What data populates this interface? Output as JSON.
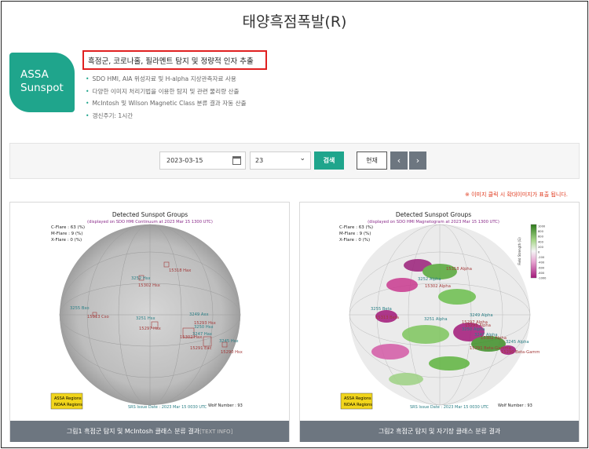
{
  "page": {
    "title": "태양흑점폭발(R)"
  },
  "logo": {
    "line1": "ASSA",
    "line2": "Sunspot"
  },
  "intro": {
    "headline": "흑점군, 코로나홀, 필라멘트 탐지 및 정량적 인자 추출",
    "bullets": [
      "SDO HMI, AIA 위성자료 및 H-alpha 지상관측자료 사용",
      "다양한 이미지 처리기법을 이용한 탐지 및 관련 물리량 산출",
      "McIntosh 및 Wilson Magnetic Class 분류 결과 자동 산출",
      "갱신주기: 1시간"
    ]
  },
  "search": {
    "date": "2023-03-15",
    "hour": "23",
    "search_label": "검색",
    "now_label": "현재",
    "prev_icon": "chevron-left-icon",
    "next_icon": "chevron-right-icon"
  },
  "notice": "※ 이미지 클릭 시 확대이미지가 표출 됩니다.",
  "colors": {
    "accent": "#1fa58c",
    "notice": "#e03a1e",
    "caption_bg": "#6d7680",
    "assa": "#a33a3a",
    "noaa": "#2a7f86"
  },
  "panel1": {
    "title": "Detected Sunspot Groups",
    "subtitle": "(displayed on SDO HMI Continuum at 2023 Mar 15 1300 UTC)",
    "flares": [
      "C-Flare : 63 (%)",
      "M-Flare :  9 (%)",
      "X-Flare :  0 (%)"
    ],
    "labels": [
      {
        "text": "15318 Hax",
        "kind": "assa"
      },
      {
        "text": "3252 Hsx",
        "kind": "noaa"
      },
      {
        "text": "15302 Hsx",
        "kind": "assa"
      },
      {
        "text": "3255 Bxo",
        "kind": "noaa"
      },
      {
        "text": "15313 Cso",
        "kind": "assa"
      },
      {
        "text": "3251 Hsx",
        "kind": "noaa"
      },
      {
        "text": "3249 Axx",
        "kind": "noaa"
      },
      {
        "text": "15297 Hsx",
        "kind": "assa"
      },
      {
        "text": "15293 Hsx",
        "kind": "assa"
      },
      {
        "text": "3250 Hsx",
        "kind": "noaa"
      },
      {
        "text": "3247 Hax",
        "kind": "noaa"
      },
      {
        "text": "15302 Hax",
        "kind": "assa"
      },
      {
        "text": "15291 Eac",
        "kind": "assa"
      },
      {
        "text": "3245 Hsx",
        "kind": "noaa"
      },
      {
        "text": "15290 Hsx",
        "kind": "assa"
      }
    ],
    "legend": [
      "ASSA Regions",
      "NOAA Regions"
    ],
    "issue": "SRS Issue Date : 2023 Mar 15 0030 UTC",
    "wolf": "Wolf Number : 93",
    "caption": "그림1 흑점군 탐지 및 McIntosh 클래스 분류 결과",
    "caption_info": "[TEXT INFO]"
  },
  "panel2": {
    "title": "Detected Sunspot Groups",
    "subtitle": "(displayed on SDO HMI Magnetogram at 2023 Mar 15 1300 UTC)",
    "flares": [
      "C-Flare : 63 (%)",
      "M-Flare :  9 (%)",
      "X-Flare :  0 (%)"
    ],
    "labels": [
      {
        "text": "15318 Alpha",
        "kind": "assa"
      },
      {
        "text": "3252 Alpha",
        "kind": "noaa"
      },
      {
        "text": "15302 Alpha",
        "kind": "assa"
      },
      {
        "text": "3255 Beta",
        "kind": "noaa"
      },
      {
        "text": "15313 Beta",
        "kind": "assa"
      },
      {
        "text": "3251 Alpha",
        "kind": "noaa"
      },
      {
        "text": "3249 Alpha",
        "kind": "noaa"
      },
      {
        "text": "15297 Alpha",
        "kind": "assa"
      },
      {
        "text": "15293 Alpha",
        "kind": "assa"
      },
      {
        "text": "3250 Alpha",
        "kind": "noaa"
      },
      {
        "text": "3247 Alpha",
        "kind": "noaa"
      },
      {
        "text": "15302 Alpha",
        "kind": "assa"
      },
      {
        "text": "3245 Alpha",
        "kind": "noaa"
      },
      {
        "text": "15291 Beta-Gamma",
        "kind": "assa"
      },
      {
        "text": "15290 Beta-Gamm",
        "kind": "assa"
      }
    ],
    "colorbar_ticks": [
      "1000",
      "800",
      "600",
      "400",
      "200",
      "0",
      "-200",
      "-400",
      "-600",
      "-800",
      "-1000"
    ],
    "colorbar_label": "Field Strength (G)",
    "legend": [
      "ASSA Regions",
      "NOAA Regions"
    ],
    "issue": "SRS Issue Date : 2023 Mar 15 0030 UTC",
    "wolf": "Wolf Number : 93",
    "caption": "그림2 흑점군 탐지 및 자기장 클래스 분류 결과"
  }
}
